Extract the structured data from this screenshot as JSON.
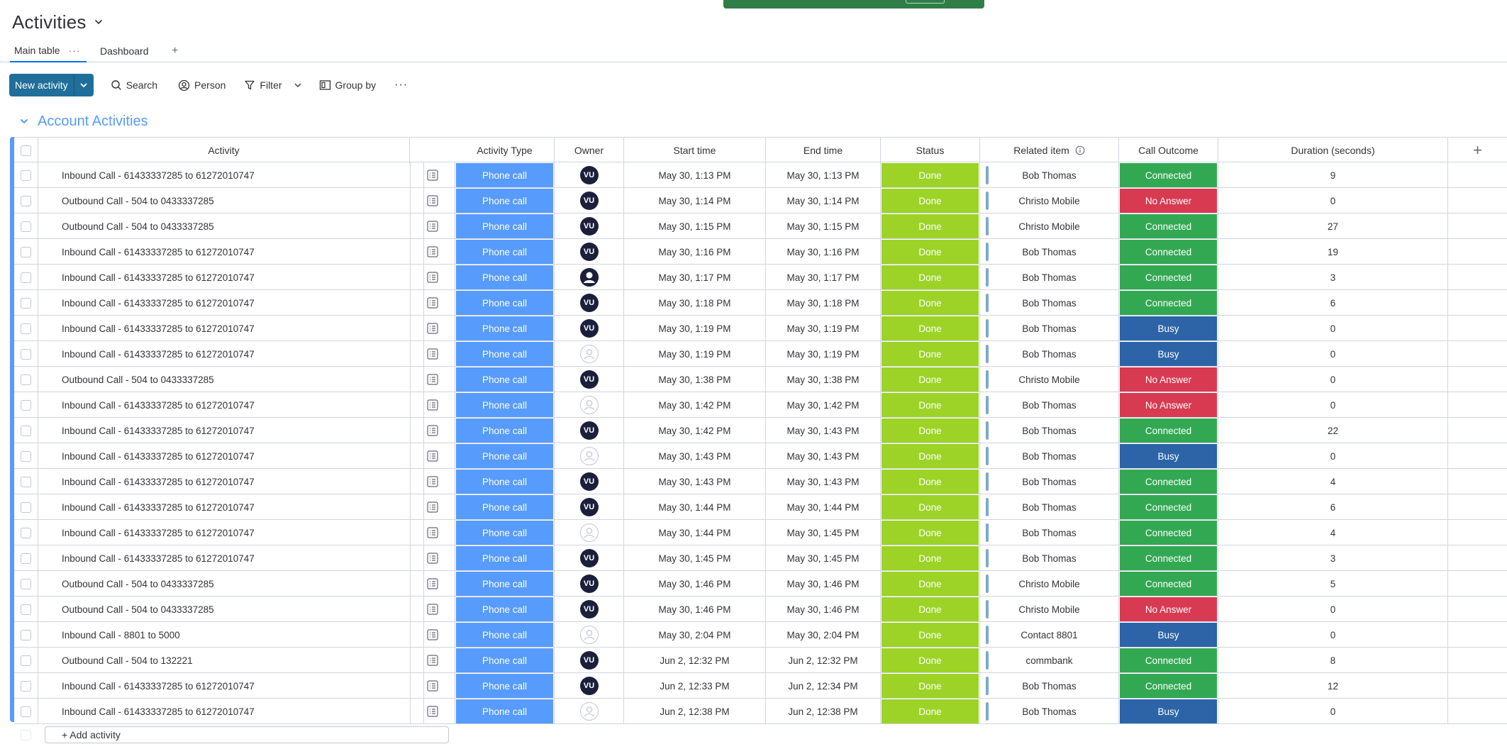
{
  "board": {
    "title": "Activities"
  },
  "tabs": [
    {
      "label": "Main table"
    },
    {
      "label": "Dashboard"
    }
  ],
  "tabs_extra": {
    "dots": "···",
    "add": "+"
  },
  "toolbar": {
    "new_label": "New activity",
    "search": "Search",
    "person": "Person",
    "filter": "Filter",
    "group_by": "Group by",
    "more": "···"
  },
  "group": {
    "title": "Account Activities"
  },
  "columns": {
    "activity": "Activity",
    "type": "Activity Type",
    "owner": "Owner",
    "start": "Start time",
    "end": "End time",
    "status": "Status",
    "related": "Related item",
    "outcome": "Call Outcome",
    "duration": "Duration (seconds)",
    "add": "+"
  },
  "colors": {
    "connected": "#33a853",
    "no_answer": "#d83a52",
    "busy": "#2d64a8",
    "done": "#9cd326",
    "phone_call": "#579bfc"
  },
  "rows": [
    {
      "name": "Inbound Call - 61433337285 to 61272010747",
      "type": "Phone call",
      "owner": "VU",
      "start": "May 30, 1:13 PM",
      "end": "May 30, 1:13 PM",
      "status": "Done",
      "related": "Bob Thomas",
      "outcome": "Connected",
      "duration": "9"
    },
    {
      "name": "Outbound Call - 504 to 0433337285",
      "type": "Phone call",
      "owner": "VU",
      "start": "May 30, 1:14 PM",
      "end": "May 30, 1:14 PM",
      "status": "Done",
      "related": "Christo Mobile",
      "outcome": "No Answer",
      "duration": "0"
    },
    {
      "name": "Outbound Call - 504 to 0433337285",
      "type": "Phone call",
      "owner": "VU",
      "start": "May 30, 1:15 PM",
      "end": "May 30, 1:15 PM",
      "status": "Done",
      "related": "Christo Mobile",
      "outcome": "Connected",
      "duration": "27"
    },
    {
      "name": "Inbound Call - 61433337285 to 61272010747",
      "type": "Phone call",
      "owner": "VU",
      "start": "May 30, 1:16 PM",
      "end": "May 30, 1:16 PM",
      "status": "Done",
      "related": "Bob Thomas",
      "outcome": "Connected",
      "duration": "19"
    },
    {
      "name": "Inbound Call - 61433337285 to 61272010747",
      "type": "Phone call",
      "owner": "photo",
      "start": "May 30, 1:17 PM",
      "end": "May 30, 1:17 PM",
      "status": "Done",
      "related": "Bob Thomas",
      "outcome": "Connected",
      "duration": "3"
    },
    {
      "name": "Inbound Call - 61433337285 to 61272010747",
      "type": "Phone call",
      "owner": "VU",
      "start": "May 30, 1:18 PM",
      "end": "May 30, 1:18 PM",
      "status": "Done",
      "related": "Bob Thomas",
      "outcome": "Connected",
      "duration": "6"
    },
    {
      "name": "Inbound Call - 61433337285 to 61272010747",
      "type": "Phone call",
      "owner": "VU",
      "start": "May 30, 1:19 PM",
      "end": "May 30, 1:19 PM",
      "status": "Done",
      "related": "Bob Thomas",
      "outcome": "Busy",
      "duration": "0"
    },
    {
      "name": "Inbound Call - 61433337285 to 61272010747",
      "type": "Phone call",
      "owner": "empty",
      "start": "May 30, 1:19 PM",
      "end": "May 30, 1:19 PM",
      "status": "Done",
      "related": "Bob Thomas",
      "outcome": "Busy",
      "duration": "0"
    },
    {
      "name": "Outbound Call - 504 to 0433337285",
      "type": "Phone call",
      "owner": "VU",
      "start": "May 30, 1:38 PM",
      "end": "May 30, 1:38 PM",
      "status": "Done",
      "related": "Christo Mobile",
      "outcome": "No Answer",
      "duration": "0"
    },
    {
      "name": "Inbound Call - 61433337285 to 61272010747",
      "type": "Phone call",
      "owner": "empty",
      "start": "May 30, 1:42 PM",
      "end": "May 30, 1:42 PM",
      "status": "Done",
      "related": "Bob Thomas",
      "outcome": "No Answer",
      "duration": "0"
    },
    {
      "name": "Inbound Call - 61433337285 to 61272010747",
      "type": "Phone call",
      "owner": "VU",
      "start": "May 30, 1:42 PM",
      "end": "May 30, 1:43 PM",
      "status": "Done",
      "related": "Bob Thomas",
      "outcome": "Connected",
      "duration": "22"
    },
    {
      "name": "Inbound Call - 61433337285 to 61272010747",
      "type": "Phone call",
      "owner": "empty",
      "start": "May 30, 1:43 PM",
      "end": "May 30, 1:43 PM",
      "status": "Done",
      "related": "Bob Thomas",
      "outcome": "Busy",
      "duration": "0"
    },
    {
      "name": "Inbound Call - 61433337285 to 61272010747",
      "type": "Phone call",
      "owner": "VU",
      "start": "May 30, 1:43 PM",
      "end": "May 30, 1:43 PM",
      "status": "Done",
      "related": "Bob Thomas",
      "outcome": "Connected",
      "duration": "4"
    },
    {
      "name": "Inbound Call - 61433337285 to 61272010747",
      "type": "Phone call",
      "owner": "VU",
      "start": "May 30, 1:44 PM",
      "end": "May 30, 1:44 PM",
      "status": "Done",
      "related": "Bob Thomas",
      "outcome": "Connected",
      "duration": "6"
    },
    {
      "name": "Inbound Call - 61433337285 to 61272010747",
      "type": "Phone call",
      "owner": "empty",
      "start": "May 30, 1:44 PM",
      "end": "May 30, 1:45 PM",
      "status": "Done",
      "related": "Bob Thomas",
      "outcome": "Connected",
      "duration": "4"
    },
    {
      "name": "Inbound Call - 61433337285 to 61272010747",
      "type": "Phone call",
      "owner": "VU",
      "start": "May 30, 1:45 PM",
      "end": "May 30, 1:45 PM",
      "status": "Done",
      "related": "Bob Thomas",
      "outcome": "Connected",
      "duration": "3"
    },
    {
      "name": "Outbound Call - 504 to 0433337285",
      "type": "Phone call",
      "owner": "VU",
      "start": "May 30, 1:46 PM",
      "end": "May 30, 1:46 PM",
      "status": "Done",
      "related": "Christo Mobile",
      "outcome": "Connected",
      "duration": "5"
    },
    {
      "name": "Outbound Call - 504 to 0433337285",
      "type": "Phone call",
      "owner": "VU",
      "start": "May 30, 1:46 PM",
      "end": "May 30, 1:46 PM",
      "status": "Done",
      "related": "Christo Mobile",
      "outcome": "No Answer",
      "duration": "0"
    },
    {
      "name": "Inbound Call - 8801 to 5000",
      "type": "Phone call",
      "owner": "empty",
      "start": "May 30, 2:04 PM",
      "end": "May 30, 2:04 PM",
      "status": "Done",
      "related": "Contact 8801",
      "outcome": "Busy",
      "duration": "0"
    },
    {
      "name": "Outbound Call - 504 to 132221",
      "type": "Phone call",
      "owner": "VU",
      "start": "Jun 2, 12:32 PM",
      "end": "Jun 2, 12:32 PM",
      "status": "Done",
      "related": "commbank",
      "outcome": "Connected",
      "duration": "8"
    },
    {
      "name": "Inbound Call - 61433337285 to 61272010747",
      "type": "Phone call",
      "owner": "VU",
      "start": "Jun 2, 12:33 PM",
      "end": "Jun 2, 12:34 PM",
      "status": "Done",
      "related": "Bob Thomas",
      "outcome": "Connected",
      "duration": "12"
    },
    {
      "name": "Inbound Call - 61433337285 to 61272010747",
      "type": "Phone call",
      "owner": "empty",
      "start": "Jun 2, 12:38 PM",
      "end": "Jun 2, 12:38 PM",
      "status": "Done",
      "related": "Bob Thomas",
      "outcome": "Busy",
      "duration": "0"
    }
  ],
  "add_row": {
    "label": "+ Add activity"
  }
}
